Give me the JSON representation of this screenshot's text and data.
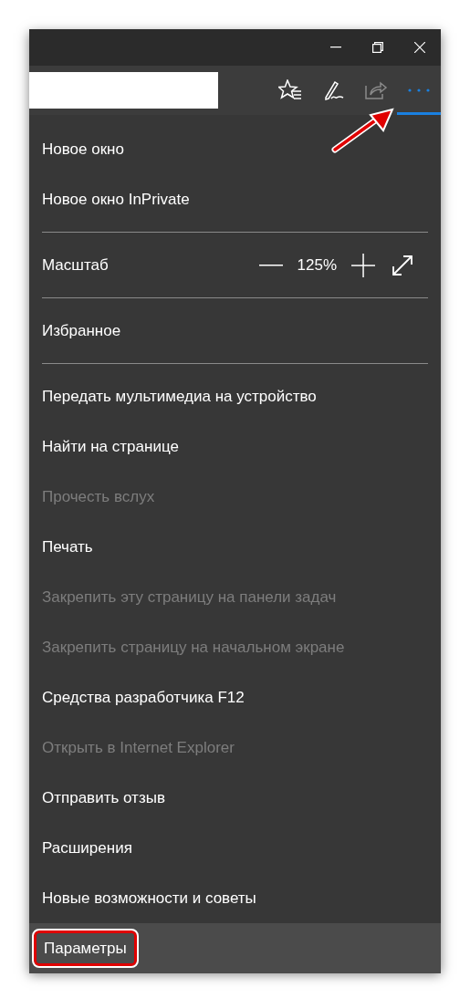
{
  "toolbar": {
    "more_selected": true
  },
  "menu": [
    {
      "kind": "item",
      "label": "Новое окно",
      "disabled": false,
      "selected": false
    },
    {
      "kind": "item",
      "label": "Новое окно InPrivate",
      "disabled": false,
      "selected": false
    },
    {
      "kind": "separator"
    },
    {
      "kind": "zoom",
      "label": "Масштаб",
      "value": "125%"
    },
    {
      "kind": "separator"
    },
    {
      "kind": "item",
      "label": "Избранное",
      "disabled": false,
      "selected": false
    },
    {
      "kind": "separator"
    },
    {
      "kind": "item",
      "label": "Передать мультимедиа на устройство",
      "disabled": false,
      "selected": false
    },
    {
      "kind": "item",
      "label": "Найти на странице",
      "disabled": false,
      "selected": false
    },
    {
      "kind": "item",
      "label": "Прочесть вслух",
      "disabled": true,
      "selected": false
    },
    {
      "kind": "item",
      "label": "Печать",
      "disabled": false,
      "selected": false
    },
    {
      "kind": "item",
      "label": "Закрепить эту страницу на панели задач",
      "disabled": true,
      "selected": false
    },
    {
      "kind": "item",
      "label": "Закрепить страницу на начальном экране",
      "disabled": true,
      "selected": false
    },
    {
      "kind": "item",
      "label": "Средства разработчика F12",
      "disabled": false,
      "selected": false
    },
    {
      "kind": "item",
      "label": "Открыть в Internet Explorer",
      "disabled": true,
      "selected": false
    },
    {
      "kind": "item",
      "label": "Отправить отзыв",
      "disabled": false,
      "selected": false
    },
    {
      "kind": "item",
      "label": "Расширения",
      "disabled": false,
      "selected": false
    },
    {
      "kind": "item",
      "label": "Новые возможности и советы",
      "disabled": false,
      "selected": false
    },
    {
      "kind": "item",
      "label": "Параметры",
      "disabled": false,
      "selected": true,
      "highlighted": true
    }
  ]
}
